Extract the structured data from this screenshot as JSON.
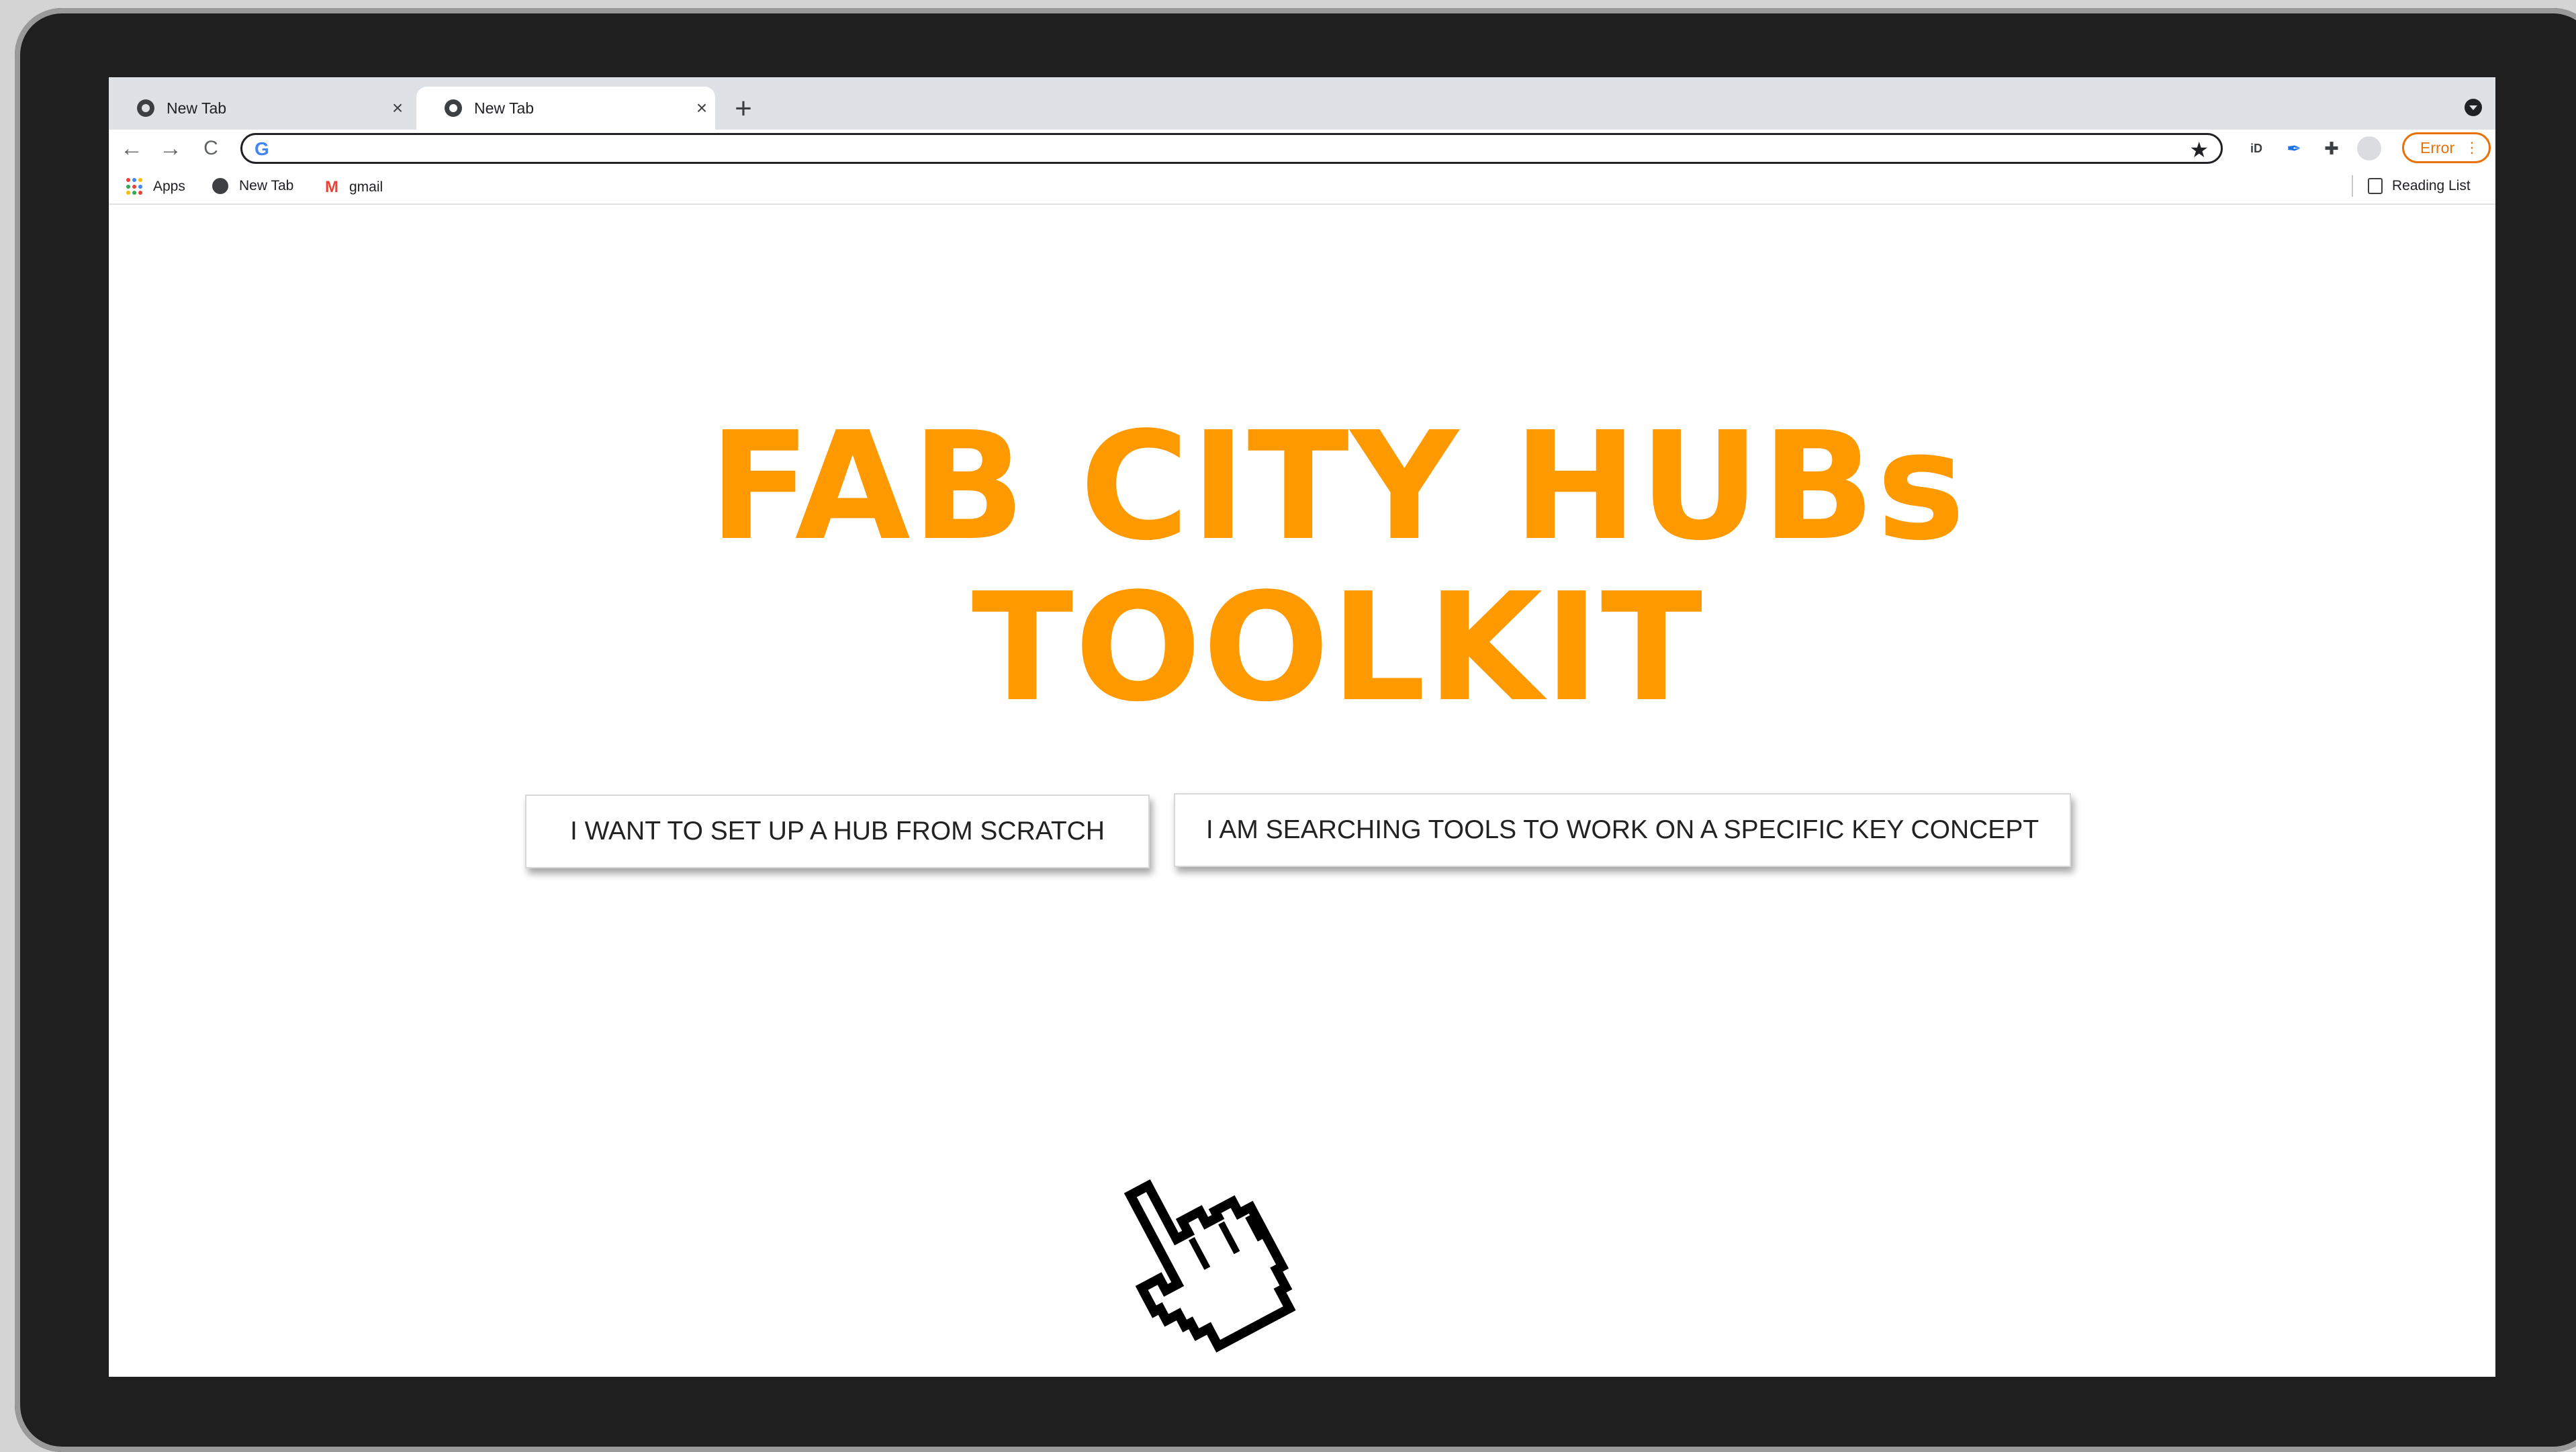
{
  "tabs": [
    {
      "title": "New Tab",
      "close": "×",
      "active": false
    },
    {
      "title": "New Tab",
      "close": "×",
      "active": true
    }
  ],
  "toolbar": {
    "back": "←",
    "forward": "→",
    "reload": "C",
    "omnibox_logo": "G",
    "star": "★",
    "error_label": "Error",
    "error_menu": "⋮",
    "new_tab": "+"
  },
  "bookmarks": [
    {
      "label": "Apps",
      "icon": "apps-grid-icon"
    },
    {
      "label": "New Tab",
      "icon": "globe-icon"
    },
    {
      "label": "gmail",
      "icon": "gmail-icon"
    }
  ],
  "reading_list": "Reading List",
  "hero": {
    "line1": "FAB CITY HUBs",
    "line2": "TOOLKIT",
    "color": "#ff9900"
  },
  "buttons": {
    "setup_hub": "I WANT TO SET UP A HUB FROM SCRATCH",
    "search_tools": "I AM SEARCHING TOOLS TO WORK ON  A SPECIFIC KEY CONCEPT"
  },
  "icons": {
    "cursor": "hand-pointer-icon"
  }
}
